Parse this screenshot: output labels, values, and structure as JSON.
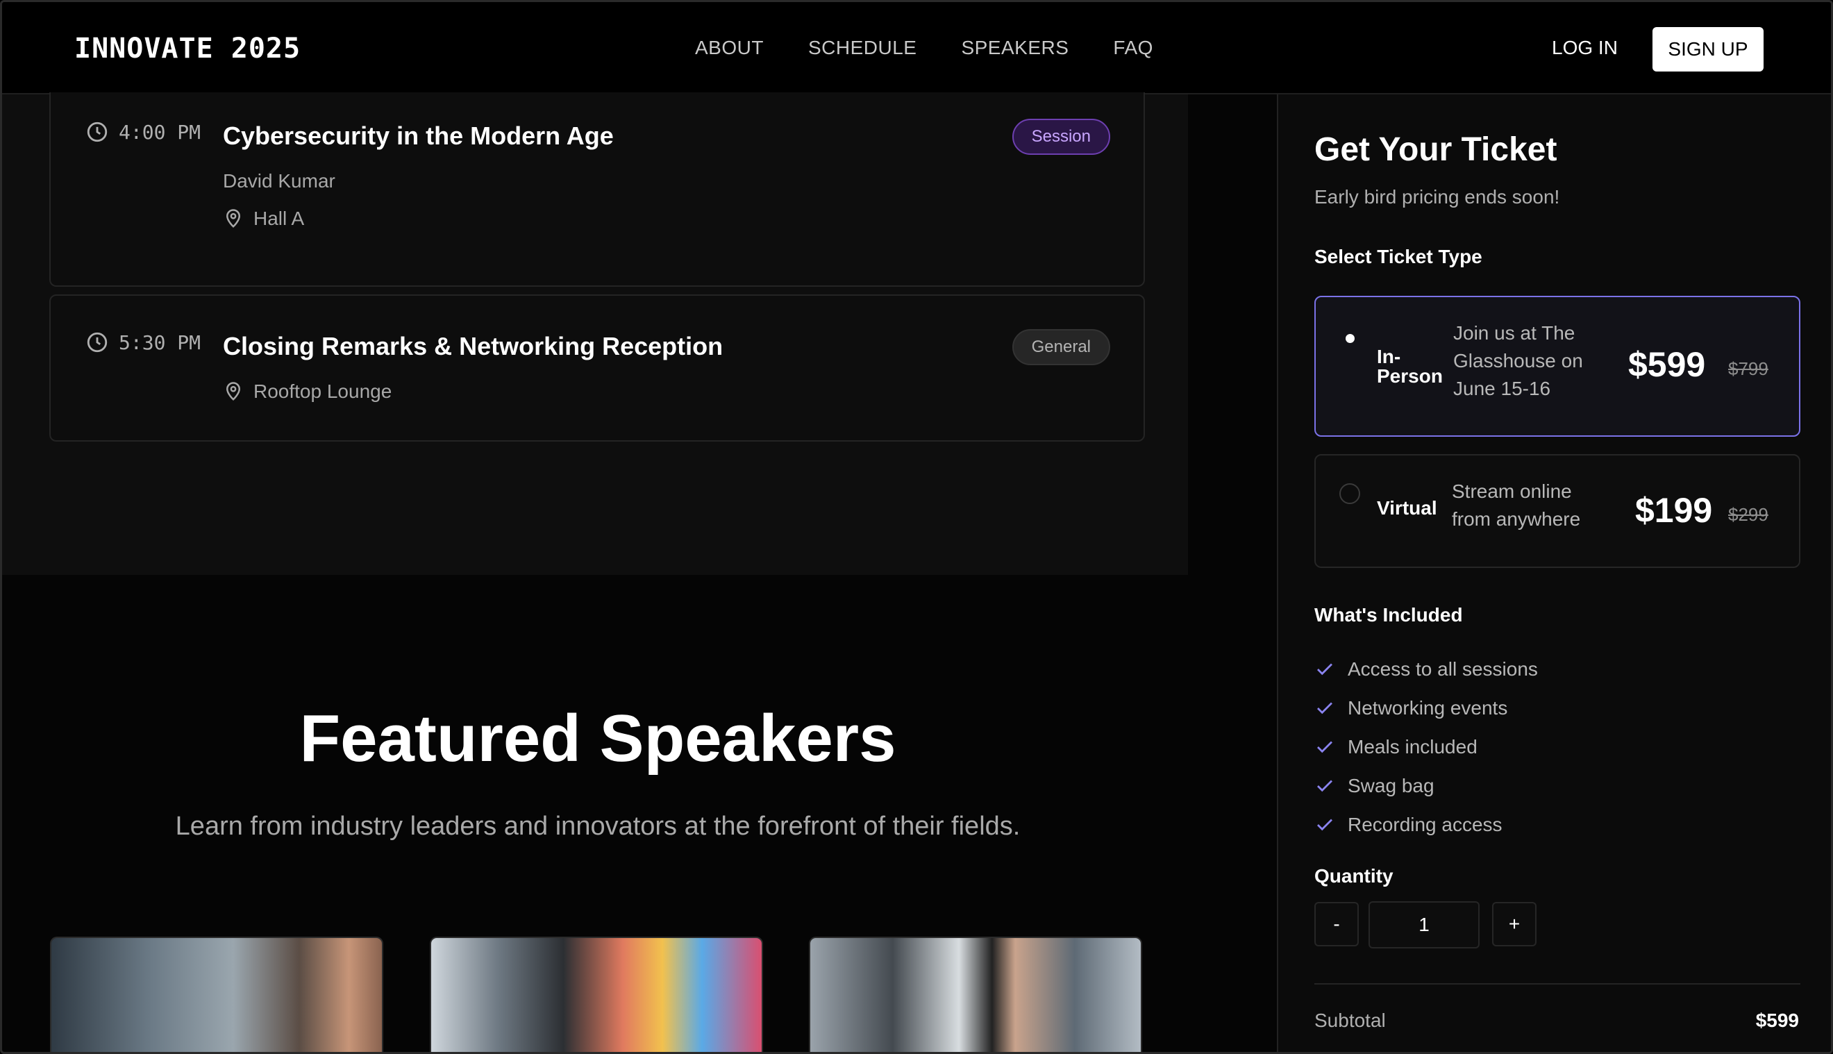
{
  "header": {
    "logo": "INNOVATE 2025",
    "nav": [
      "ABOUT",
      "SCHEDULE",
      "SPEAKERS",
      "FAQ"
    ],
    "login": "LOG IN",
    "signup": "SIGN UP"
  },
  "schedule": {
    "sessions": [
      {
        "time": "4:00 PM",
        "title": "Cybersecurity in the Modern Age",
        "speaker": "David Kumar",
        "location": "Hall A",
        "tag": "Session"
      },
      {
        "time": "5:30 PM",
        "title": "Closing Remarks & Networking Reception",
        "location": "Rooftop Lounge",
        "tag": "General"
      }
    ]
  },
  "speakers": {
    "title": "Featured Speakers",
    "subtitle": "Learn from industry leaders and innovators at the forefront of their fields."
  },
  "ticket": {
    "title": "Get Your Ticket",
    "subtitle": "Early bird pricing ends soon!",
    "select_label": "Select Ticket Type",
    "options": [
      {
        "name_line1": "In-",
        "name_line2": "Person",
        "desc_line1": "Join us at The",
        "desc_line2": "Glasshouse on",
        "desc_line3": "June 15-16",
        "price": "$599",
        "old_price": "$799",
        "selected": true
      },
      {
        "name": "Virtual",
        "desc_line1": "Stream online",
        "desc_line2": "from anywhere",
        "price": "$199",
        "old_price": "$299",
        "selected": false
      }
    ],
    "included_label": "What's Included",
    "included": [
      "Access to all sessions",
      "Networking events",
      "Meals included",
      "Swag bag",
      "Recording access"
    ],
    "quantity_label": "Quantity",
    "quantity": "1",
    "minus": "-",
    "plus": "+",
    "subtotal_label": "Subtotal",
    "subtotal": "$599"
  },
  "colors": {
    "accent": "#7b72e8",
    "session_badge": "#6d3fb0",
    "background": "#050505"
  }
}
